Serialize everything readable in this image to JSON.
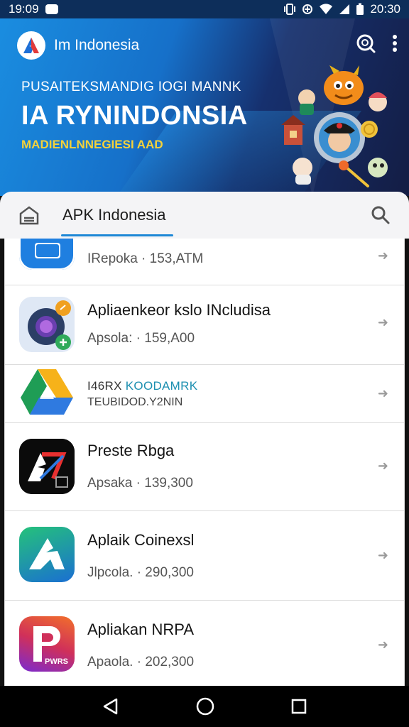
{
  "status": {
    "time_left": "19:09",
    "time_right": "20:30"
  },
  "banner": {
    "brand": "Im Indonesia",
    "line1": "PUSAITEKSMANDIG IOGI MANNK",
    "line2": "IA RYNINDONSIA",
    "line3": "MADIENLNNEGIESI AAD"
  },
  "appbar": {
    "title": "APK Indonesia"
  },
  "apps": [
    {
      "meta": "IRepoka · 153,ATM"
    },
    {
      "name": "Apliaenkeor kslo INcludisa",
      "meta": "Apsola: · 159,A00"
    },
    {
      "line1a": "I46RX ",
      "line1b": "KOODAMRK",
      "line2": "TEUBIDOD.Y2NIN"
    },
    {
      "name": "Preste Rbga",
      "meta": "Apsaka · 139,300"
    },
    {
      "name": "Aplaik Coinexsl",
      "meta": "Jlpcola. · 290,300"
    },
    {
      "name": "Apliakan NRPA",
      "meta": "Apaola. · 202,300",
      "icon_text": "PWRS"
    }
  ],
  "colors": {
    "accent": "#1e88d6",
    "banner_dark": "#141d44",
    "banner_light": "#1a8de0",
    "headline_yellow": "#f4d23a"
  }
}
